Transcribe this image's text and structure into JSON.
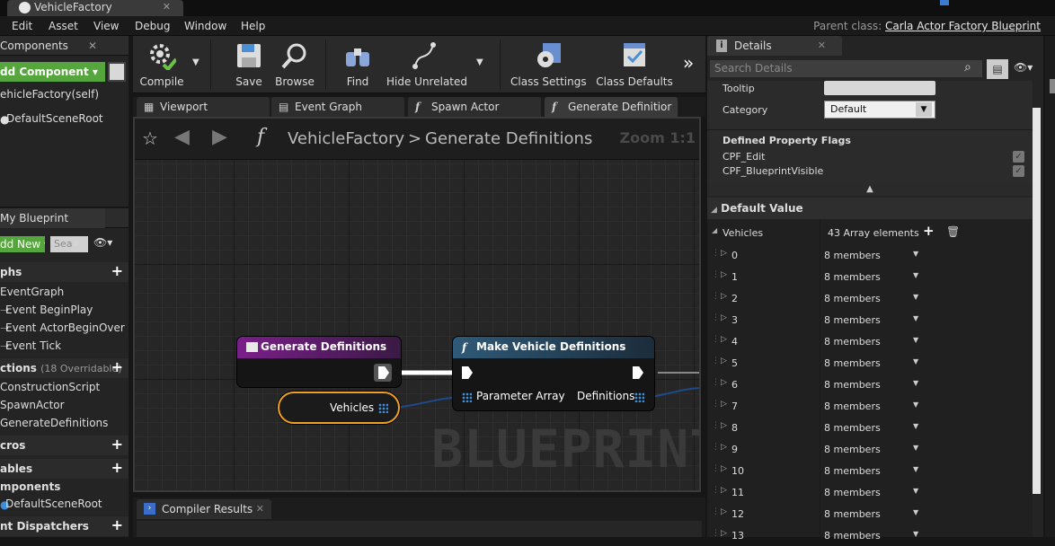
{
  "window": {
    "tab_title": "VehicleFactory",
    "parent_class_label": "Parent class:",
    "parent_class_value": "Carla Actor Factory Blueprint"
  },
  "menu": [
    "Edit",
    "Asset",
    "View",
    "Debug",
    "Window",
    "Help"
  ],
  "components": {
    "title": "Components",
    "add_button": "dd Component",
    "self_row": "ehicleFactory(self)",
    "root": "DefaultSceneRoot"
  },
  "my_blueprint": {
    "title": "My Blueprint",
    "add_new": "dd New",
    "search_placeholder": "Sea",
    "sections": {
      "graphs": "phs",
      "functions": "ctions",
      "functions_note": "(18 Overridable)",
      "macros": "cros",
      "variables": "ables",
      "components": "mponents",
      "dispatchers": "nt Dispatchers"
    },
    "graph_items": [
      "EventGraph",
      "Event BeginPlay",
      "Event ActorBeginOver",
      "Event Tick"
    ],
    "function_items": [
      "ConstructionScript",
      "SpawnActor",
      "GenerateDefinitions"
    ],
    "component_items": [
      "DefaultSceneRoot"
    ]
  },
  "toolbar": {
    "compile": "Compile",
    "save": "Save",
    "browse": "Browse",
    "find": "Find",
    "hide_unrelated": "Hide Unrelated",
    "class_settings": "Class Settings",
    "class_defaults": "Class Defaults"
  },
  "editor_tabs": [
    "Viewport",
    "Event Graph",
    "Spawn Actor",
    "Generate Definitior"
  ],
  "graph": {
    "breadcrumb_root": "VehicleFactory",
    "breadcrumb_sep": ">",
    "breadcrumb_current": "Generate Definitions",
    "zoom": "Zoom 1:1",
    "watermark": "BLUEPRINT",
    "node_entry": "Generate Definitions",
    "node_var": "Vehicles",
    "node_make": "Make Vehicle Definitions",
    "pin_in": "Parameter Array",
    "pin_out": "Definitions"
  },
  "compiler": {
    "tab": "Compiler Results"
  },
  "details": {
    "title": "Details",
    "search_placeholder": "Search Details",
    "tooltip_label": "Tooltip",
    "category_label": "Category",
    "category_value": "Default",
    "flags_title": "Defined Property Flags",
    "flags": [
      "CPF_Edit",
      "CPF_BlueprintVisible"
    ],
    "default_value_title": "Default Value",
    "vehicles_label": "Vehicles",
    "vehicles_count": "43 Array elements",
    "members_label": "8 members",
    "elements": [
      "0",
      "1",
      "2",
      "3",
      "4",
      "5",
      "6",
      "7",
      "8",
      "9",
      "10",
      "11",
      "12",
      "13"
    ]
  }
}
